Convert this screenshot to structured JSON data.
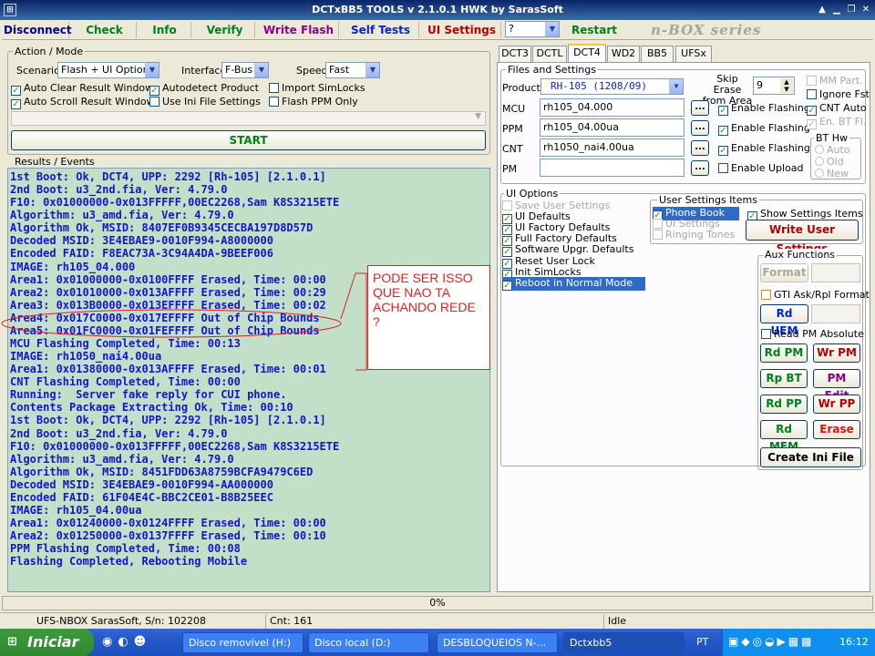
{
  "window": {
    "title": "DCTxBB5 TOOLS v 2.1.0.1 HWK by SarasSoft",
    "sys_glyph": "⊞",
    "min": "▁",
    "max": "▭",
    "restore": "❐",
    "close": "✕",
    "arrow_up": "▲"
  },
  "toolbar": {
    "disconnect": "Disconnect",
    "check": "Check",
    "info": "Info",
    "verify": "Verify",
    "write_flash": "Write Flash",
    "self_tests": "Self Tests",
    "ui_settings": "UI Settings",
    "help_value": "?",
    "restart": "Restart",
    "brand": "n-BOX series"
  },
  "action": {
    "legend": "Action / Mode",
    "scenario_label": "Scenario",
    "scenario_value": "Flash + UI Options",
    "interface_label": "Interface",
    "interface_value": "F-Bus",
    "speed_label": "Speed",
    "speed_value": "Fast",
    "auto_clear": "Auto Clear Result Window",
    "autodetect": "Autodetect Product",
    "import_simlocks": "Import SimLocks",
    "auto_scroll": "Auto Scroll Result Window",
    "use_ini": "Use Ini File Settings",
    "flash_ppm": "Flash PPM Only",
    "start": "START"
  },
  "results": {
    "legend": "Results / Events",
    "lines": [
      "1st Boot: Ok, DCT4, UPP: 2292 [Rh-105] [2.1.0.1]",
      "2nd Boot: u3_2nd.fia, Ver: 4.79.0",
      "F10: 0x01000000-0x013FFFFF,00EC2268,Sam K8S3215ETE",
      "Algorithm: u3_amd.fia, Ver: 4.79.0",
      "Algorithm Ok, MSID: 8407EF0B9345CECBA197D8D57D",
      "Decoded MSID: 3E4EBAE9-0010F994-A8000000",
      "Encoded FAID: F8EAC73A-3C94A4DA-9BEEF006",
      "IMAGE: rh105_04.000",
      "Area1: 0x01000000-0x0100FFFF Erased, Time: 00:00",
      "Area2: 0x01010000-0x013AFFFF Erased, Time: 00:29",
      "Area3: 0x013B0000-0x013EFFFF Erased, Time: 00:02",
      "Area4: 0x017C0000-0x017EFFFF Out of Chip Bounds",
      "Area5: 0x01FC0000-0x01FEFFFF Out of Chip Bounds",
      "MCU Flashing Completed, Time: 00:13",
      "IMAGE: rh1050_nai4.00ua",
      "Area1: 0x01380000-0x013AFFFF Erased, Time: 00:01",
      "CNT Flashing Completed, Time: 00:00",
      "Running:  Server fake reply for CUI phone.",
      "Contents Package Extracting Ok, Time: 00:10",
      "1st Boot: Ok, DCT4, UPP: 2292 [Rh-105] [2.1.0.1]",
      "2nd Boot: u3_2nd.fia, Ver: 4.79.0",
      "F10: 0x01000000-0x013FFFFF,00EC2268,Sam K8S3215ETE",
      "Algorithm: u3_amd.fia, Ver: 4.79.0",
      "Algorithm Ok, MSID: 8451FDD63A8759BCFA9479C6ED",
      "Decoded MSID: 3E4EBAE9-0010F994-AA000000",
      "Encoded FAID: 61F04E4C-BBC2CE01-B8B25EEC",
      "IMAGE: rh105_04.00ua",
      "Area1: 0x01240000-0x0124FFFF Erased, Time: 00:00",
      "Area2: 0x01250000-0x0137FFFF Erased, Time: 00:10",
      "PPM Flashing Completed, Time: 00:08",
      "Flashing Completed, Rebooting Mobile"
    ]
  },
  "annotation": {
    "text": "PODE SER ISSO QUE NAO TA ACHANDO REDE ?"
  },
  "tabs": [
    "DCT3",
    "DCTL",
    "DCT4",
    "WD2",
    "BB5",
    "UFSx"
  ],
  "files": {
    "legend": "Files and Settings",
    "product_label": "Product",
    "product_value": "RH-105  (1208/09)",
    "skip_erase_label": "Skip Erase from Area",
    "skip_erase_value": "9",
    "mcu_label": "MCU",
    "mcu_value": "rh105_04.000",
    "ppm_label": "PPM",
    "ppm_value": "rh105_04.00ua",
    "cnt_label": "CNT",
    "cnt_value": "rh1050_nai4.00ua",
    "pm_label": "PM",
    "pm_value": "",
    "browse": "...",
    "enable_flashing": "Enable Flashing",
    "enable_upload": "Enable Upload",
    "mm_part": "MM Part.",
    "ignore_fst": "Ignore Fst",
    "cnt_auto": "CNT Auto",
    "en_bt_fl": "En. BT Fl.",
    "bt_hw_legend": "BT Hw",
    "bt_auto": "Auto",
    "bt_old": "Old",
    "bt_new": "New"
  },
  "ui_options": {
    "legend": "UI Options",
    "items": [
      "Save User Settings",
      "UI Defaults",
      "UI Factory Defaults",
      "Full Factory Defaults",
      "Software Upgr. Defaults",
      "Reset User Lock",
      "Init SimLocks",
      "Reboot in Normal Mode"
    ],
    "user_legend": "User Settings Items",
    "user_items": [
      "Phone Book",
      "UI Settings",
      "Ringing Tones"
    ],
    "show_settings": "Show Settings Items",
    "write_user": "Write User Settings"
  },
  "aux": {
    "legend": "Aux Functions",
    "format": "Format",
    "gti": "GTI Ask/Rpl Format",
    "rd_uem": "Rd UEM",
    "read_pm_abs": "Read PM Absolute",
    "rd_pm": "Rd PM",
    "wr_pm": "Wr PM",
    "rp_bt": "Rp BT",
    "pm_edit": "PM Edit",
    "rd_pp": "Rd PP",
    "wr_pp": "Wr PP",
    "rd_mem": "Rd MEM",
    "erase": "Erase",
    "create_ini": "Create Ini File"
  },
  "progress": {
    "value": "0%"
  },
  "status": {
    "left": "UFS-NBOX  SarasSoft, S/n: 102208",
    "cnt": "Cnt: 161",
    "state": "Idle"
  },
  "taskbar": {
    "start": "Iniciar",
    "start_glyph": "⊞",
    "tasks": [
      "Disco removível (H:)",
      "Disco local (D:)",
      "DESBLOQUEIOS N-...",
      "Dctxbb5"
    ],
    "lang": "PT",
    "clock": "16:12"
  }
}
